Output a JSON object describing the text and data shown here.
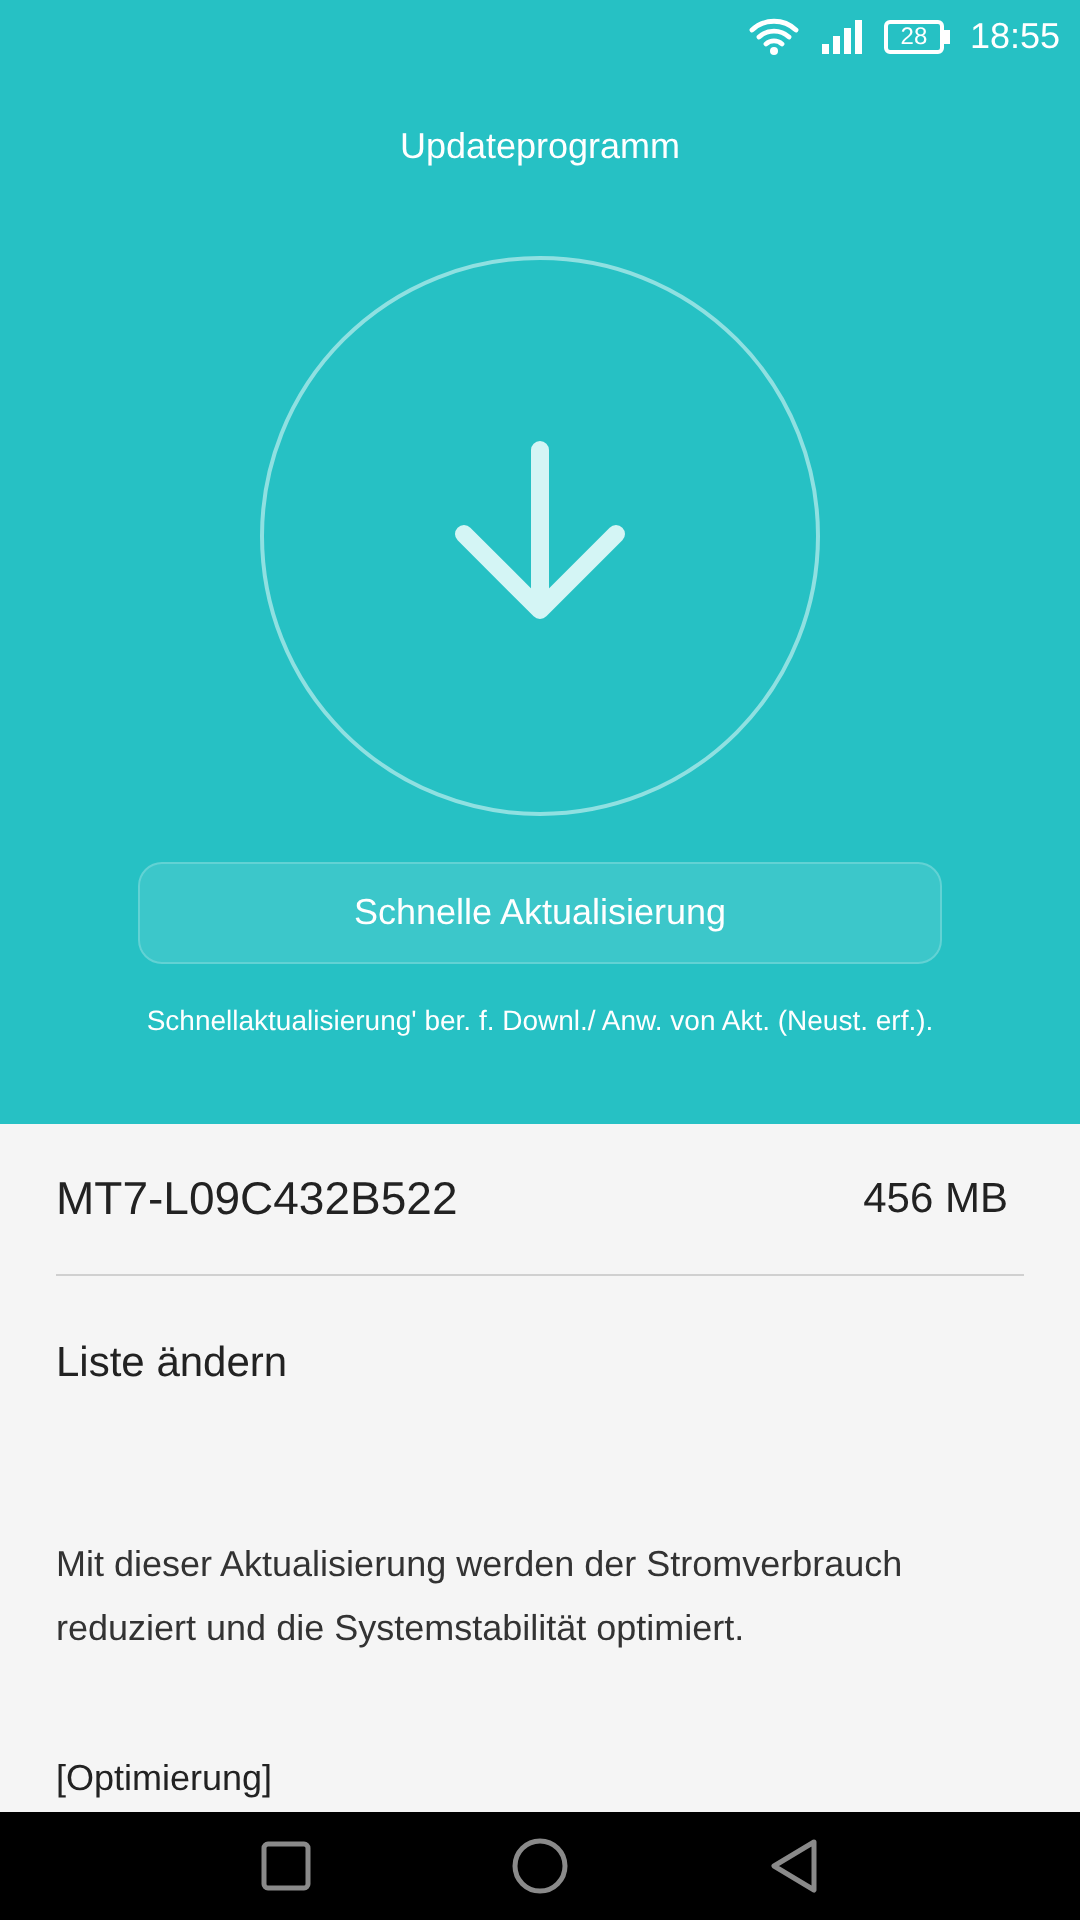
{
  "status_bar": {
    "battery": "28",
    "time": "18:55"
  },
  "header": {
    "title": "Updateprogramm"
  },
  "quick_update_button": {
    "label": "Schnelle Aktualisierung"
  },
  "quick_update_note": "Schnellaktualisierung' ber. f. Downl./ Anw. von Akt. (Neust. erf.).",
  "package": {
    "version": "MT7-L09C432B522",
    "size": "456 MB"
  },
  "change_list": {
    "label": "Liste ändern"
  },
  "description": "Mit dieser Aktualisierung werden der Stromverbrauch reduziert und die Systemstabilität optimiert.",
  "section_heading": "[Optimierung]"
}
